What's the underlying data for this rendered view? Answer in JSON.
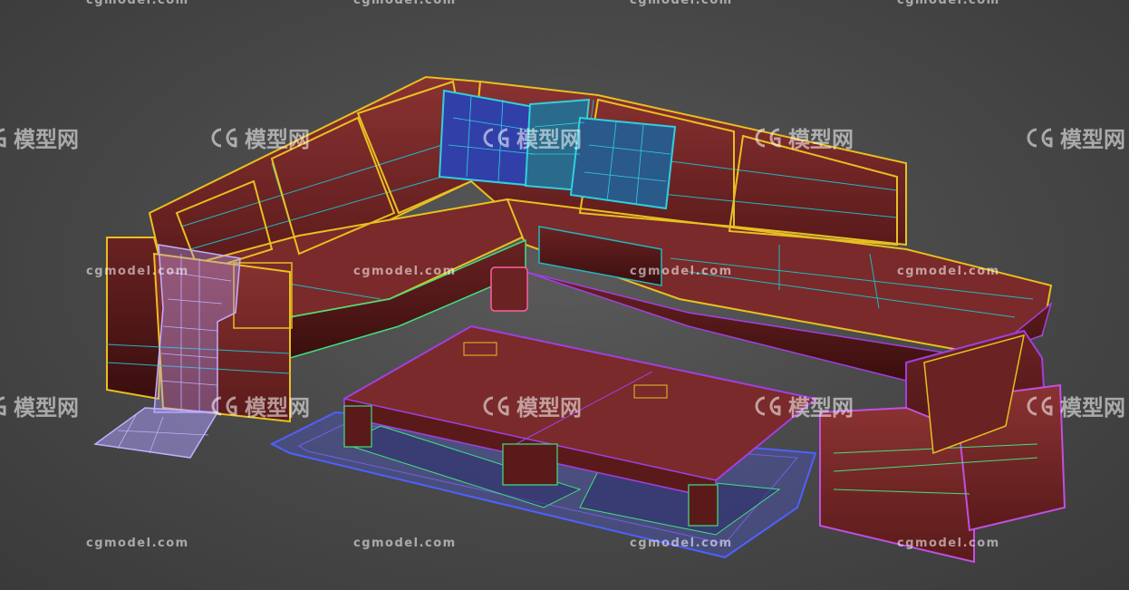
{
  "viewport": {
    "background_color": "#4a4a4a",
    "model": "sofa-set-wireframe"
  },
  "watermark": {
    "url_text": "cgmodel.com",
    "brand_text": "模型网",
    "logo_icon": "cg-logo-icon",
    "color": "#ffffff"
  },
  "wire_colors": {
    "sofa_frame": "#e8c020",
    "cushion_mesh": "#20b8c0",
    "pillow_mesh": "#30d0e0",
    "table_outline": "#a040e0",
    "rug_outline": "#5060ff",
    "armchair_outline": "#c050e0",
    "blanket_mesh": "#b0a0ff",
    "table_grid": "#40e080",
    "fill_red": "#7a2a2a"
  }
}
